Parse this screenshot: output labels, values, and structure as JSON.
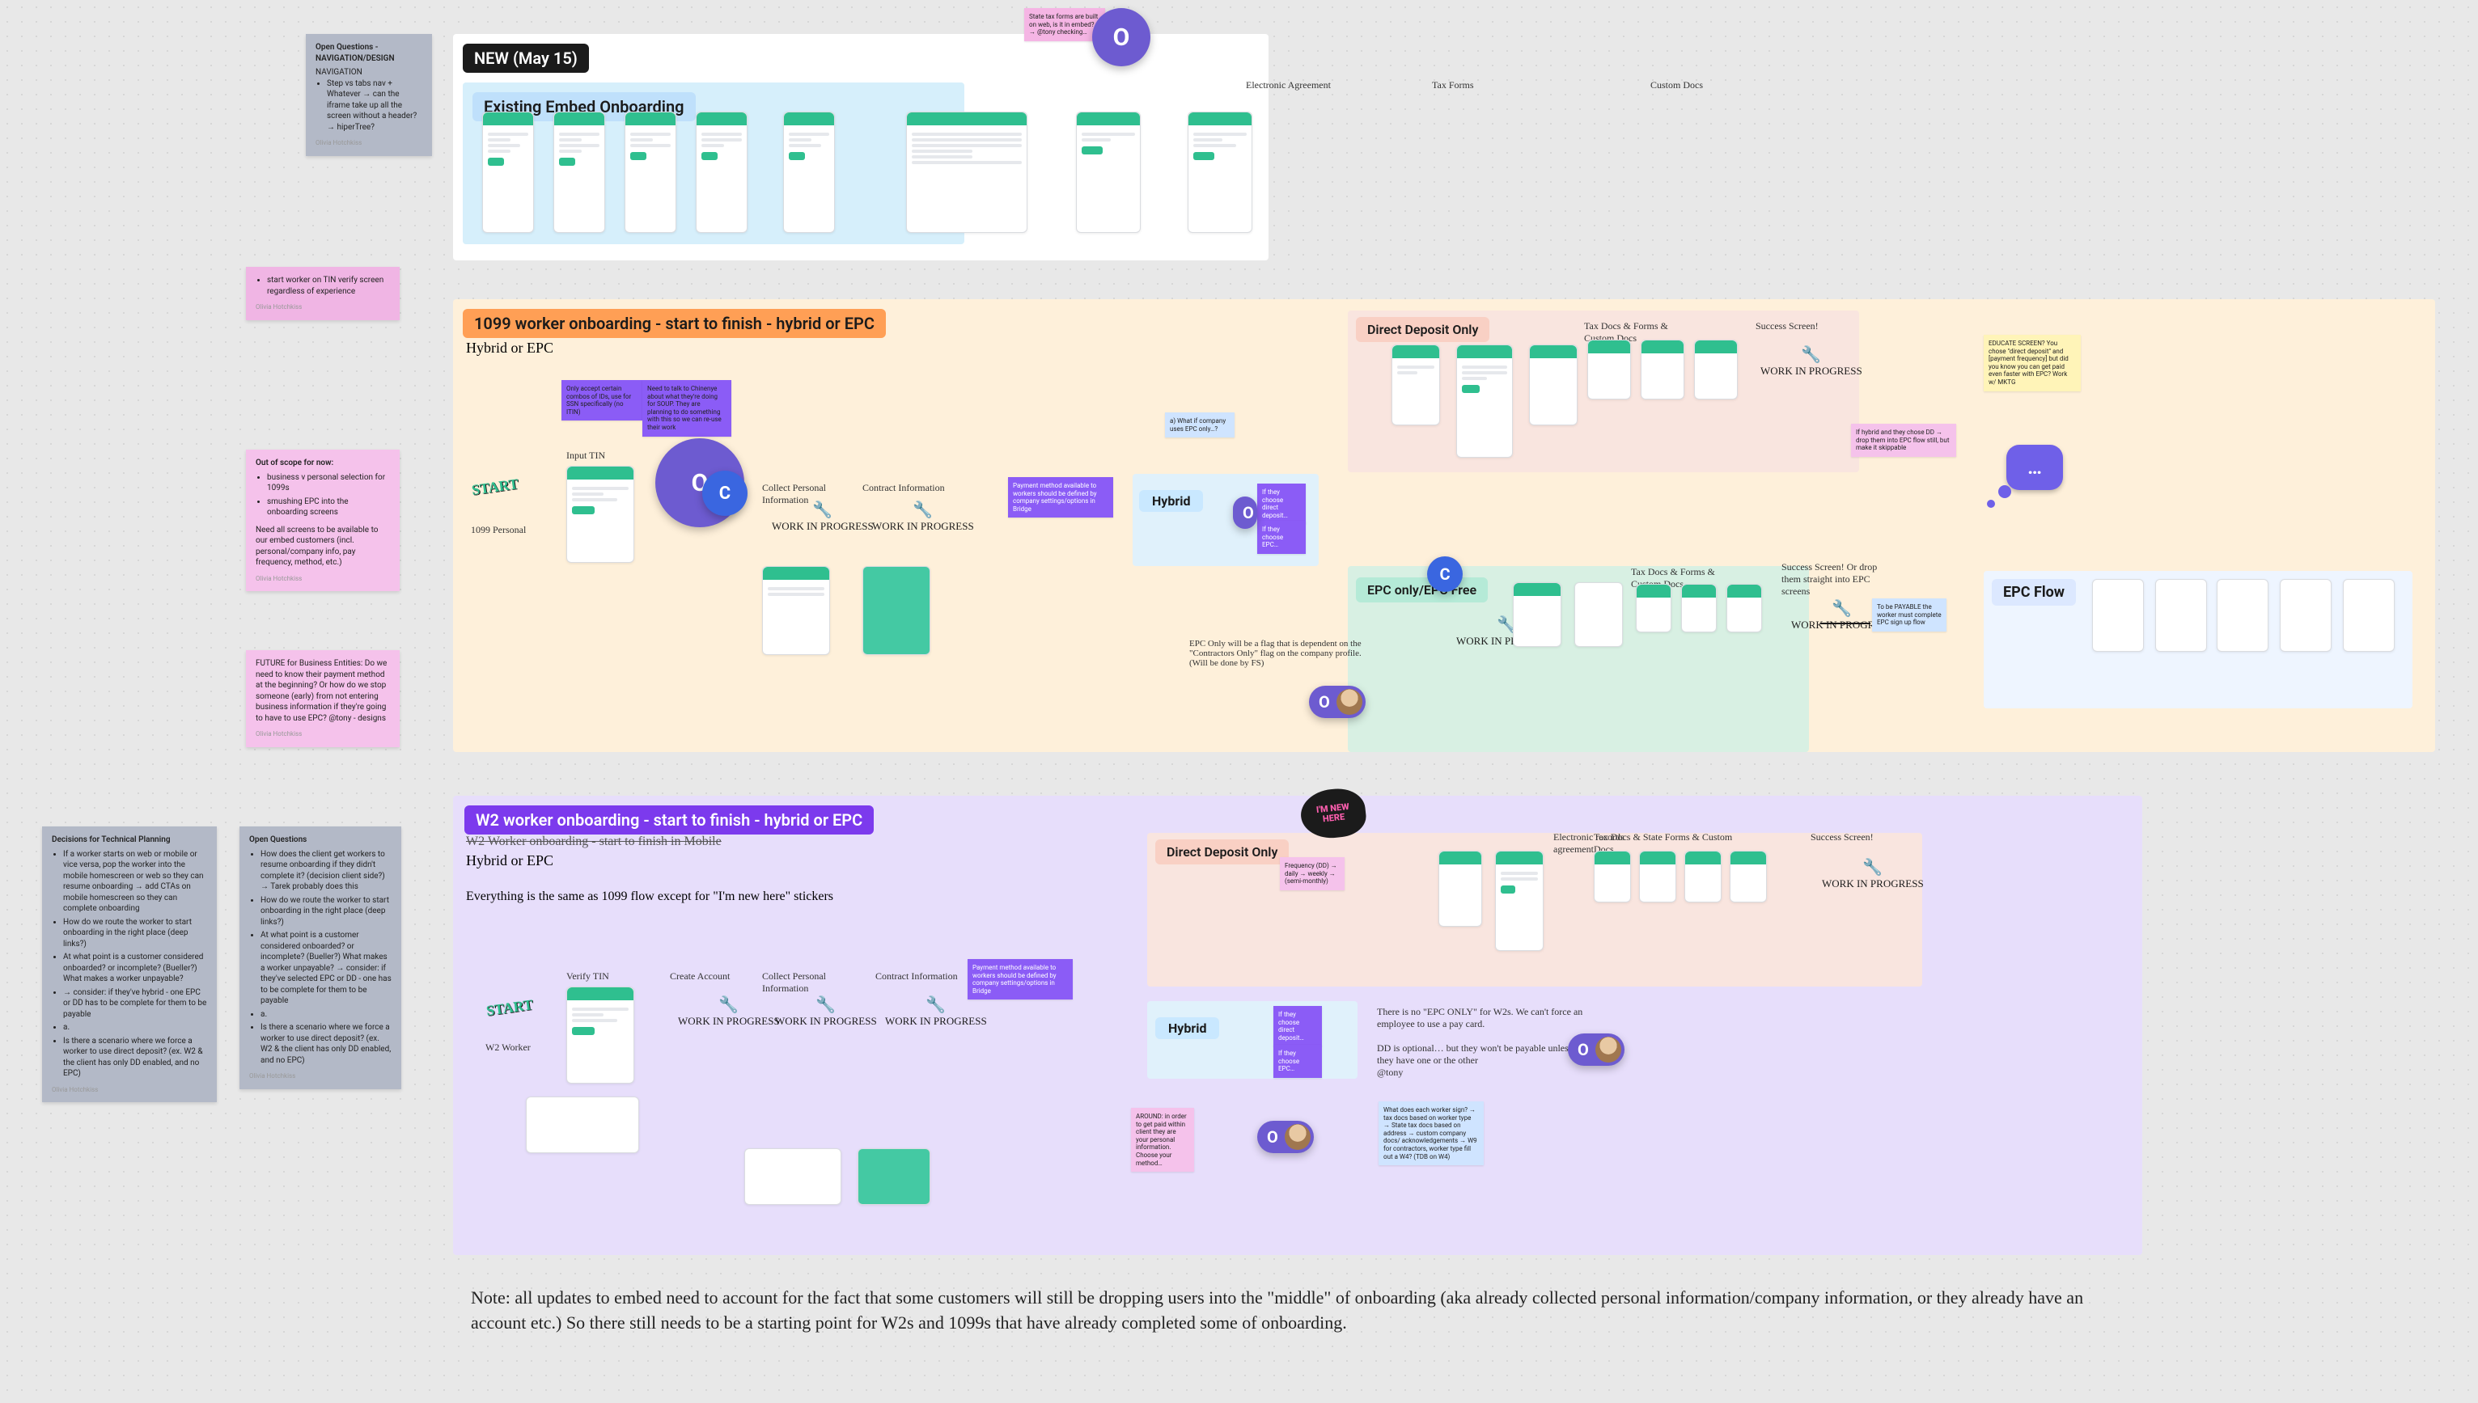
{
  "left_notes": {
    "nav_design": {
      "title": "Open Questions - NAVIGATION/DESIGN",
      "sub": "NAVIGATION",
      "bullets": [
        "Step vs tabs nav + Whatever → can the iframe take up all the screen without a header? → hiperTree?"
      ],
      "author": "Olivia Hotchkiss"
    },
    "tin": {
      "bullets": [
        "start worker on TIN verify screen regardless of experience"
      ],
      "author": "Olivia Hotchkiss"
    },
    "scope": {
      "title": "Out of scope for now:",
      "bullets": [
        "business v personal selection for 1099s",
        "smushing EPC into the onboarding screens"
      ],
      "middle": "Need all screens to be available to our embed customers (incl. personal/company info, pay frequency, method, etc.)",
      "author": "Olivia Hotchkiss"
    },
    "future": {
      "body": "FUTURE for Business Entities: Do we need to know their payment method at the beginning? Or how do we stop someone (early) from not entering business information if they're going to have to use EPC? @tony - designs",
      "author": "Olivia Hotchkiss"
    },
    "decisions": {
      "title": "Decisions for Technical Planning",
      "bullets": [
        "If a worker starts on web or mobile or vice versa, pop the worker into the mobile homescreen or web so they can resume onboarding → add CTAs on mobile homescreen so they can complete onboarding",
        "How do we route the worker to start onboarding in the right place (deep links?)",
        "At what point is a customer considered onboarded? or incomplete? (Bueller?) What makes a worker unpayable?",
        "→ consider: if they've hybrid - one EPC or DD has to be complete for them to be payable",
        "a.",
        "Is there a scenario where we force a worker to use direct deposit? (ex. W2 & the client has only DD enabled, and no EPC)"
      ],
      "author": "Olivia Hotchkiss"
    },
    "open_questions": {
      "title": "Open Questions",
      "bullets": [
        "How does the client get workers to resume onboarding if they didn't complete it? (decision client side?) → Tarek probably does this",
        "How do we route the worker to start onboarding in the right place (deep links?)",
        "At what point is a customer considered onboarded? or incomplete? (Bueller?) What makes a worker unpayable? → consider: if they've selected EPC or DD - one has to be complete for them to be payable",
        "a.",
        "Is there a scenario where we force a worker to use direct deposit? (ex. W2 & the client has only DD enabled, and no EPC)"
      ],
      "author": "Olivia Hotchkiss"
    }
  },
  "sections": {
    "new_may15": {
      "label": "NEW (May 15)"
    },
    "existing_embed": {
      "label": "Existing Embed Onboarding",
      "cols": [
        "",
        "Electronic Agreement",
        "Tax Forms",
        "Custom Docs"
      ]
    },
    "s1099": {
      "label": "1099 worker onboarding - start to finish - hybrid or EPC",
      "sub": "Hybrid or EPC"
    },
    "w2": {
      "label": "W2 worker onboarding - start to finish - hybrid or EPC",
      "crossed": "W2 Worker onboarding - start to finish in Mobile",
      "sub": "Hybrid or EPC",
      "sameas": "Everything is the same as 1099 flow except for \"I'm new here\" stickers"
    },
    "dd_only": "Direct Deposit Only",
    "epc_only": "EPC only/EPC Free",
    "epc_flow": "EPC Flow",
    "hybrid": "Hybrid"
  },
  "captions": {
    "c1099_personal": "1099 Personal",
    "input_tin": "Input TIN",
    "collect_personal": "Collect Personal Information",
    "contract_info": "Contract Information",
    "verify_tin": "Verify TIN",
    "create_acct": "Create Account",
    "w2_worker": "W2 Worker",
    "tax_forms_custom": "Tax Docs & Forms & Custom Docs",
    "tax_state_custom": "Tax Docs & State Forms & Custom Docs",
    "electronic_records": "Electronic records agreement",
    "success_screen": "Success Screen!",
    "success_or_drop": "Success Screen! Or drop them straight into EPC screens"
  },
  "tiny_sticky_purple_1": "Only accept certain combos of IDs, use for SSN specifically (no ITIN)",
  "tiny_sticky_purple_2": "Need to talk to Chinenye about what they're doing for SOUP. They are planning to do something with this so we can re-use their work",
  "tiny_sticky_purple_3": "Payment method available to workers should be defined by company settings/options in Bridge",
  "pink_top_note": "State tax forms are built on web, is it in embed? → @tony checking…",
  "epc_only_note": "EPC Only will be a flag that is dependent on the \"Contractors Only\" flag on the company profile. (Will be done by FS)",
  "pink_hybrid_note": "If hybrid and they chose DD → drop them into EPC flow still, but make it skippable",
  "yellow_educate": "EDUCATE SCREEN? You chose \"direct deposit\" and [payment frequency] but did you know you can get paid even faster with EPC? Work w/ MKTG",
  "blue_payable": "To be PAYABLE the worker must complete EPC sign up flow",
  "blue_if_company": "a) What if company uses EPC only…?",
  "w2_no_epc_only": "There is no \"EPC ONLY\" for W2s. We can't force an employee to use a pay card.\n\nDD is optional… but they won't be payable unless they have one or the other\n@tony",
  "blue_w2_q": "What does each worker sign? → tax docs based on worker type → State tax docs based on address → custom company docs/ acknowledgements → W9 for contractors, worker type fill out a W4? (TDB on W4)",
  "small_purple_dd": "If they choose direct deposit…",
  "small_purple_epc": "If they choose EPC…",
  "tiny_pink_frequency": "Frequency (DD) → daily → weekly → (semi-monthly)",
  "tiny_pink_around": "AROUND: in order to get paid within client they are your personal information. Choose your method…",
  "footer_note": "Note: all updates to embed need to account for the fact that some customers will still be dropping users into the \"middle\" of onboarding (aka already collected personal information/company information, or they already have an account etc.) So there still needs to be a starting point for W2s and 1099s that have already completed some of onboarding.",
  "presence": {
    "O": "O",
    "C": "C"
  },
  "wip_label": "WORK IN PROGRESS",
  "start_label": "START",
  "newhere": "I'M NEW HERE",
  "thought": "…"
}
